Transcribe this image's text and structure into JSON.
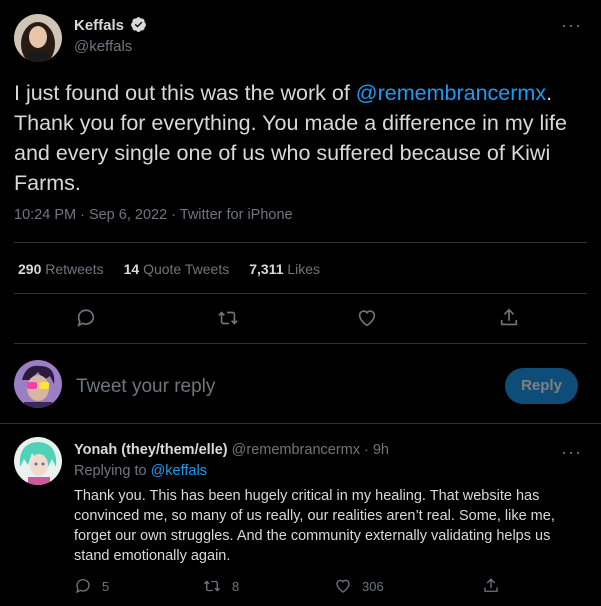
{
  "tweet": {
    "author_name": "Keffals",
    "author_handle": "@keffals",
    "verified": true,
    "more_label": "···",
    "text_before": "I just found out this was the work of ",
    "mention": "@remembrancermx",
    "text_after": ". Thank you for everything. You made a difference in my life and every single one of us who suffered because of Kiwi Farms.",
    "meta": "10:24 PM · Sep 6, 2022 · Twitter for iPhone",
    "stats": {
      "retweets_count": "290",
      "retweets_label": "Retweets",
      "quotes_count": "14",
      "quotes_label": "Quote Tweets",
      "likes_count": "7,311",
      "likes_label": "Likes"
    }
  },
  "compose": {
    "placeholder": "Tweet your reply",
    "reply_button": "Reply"
  },
  "reply": {
    "author_name": "Yonah (they/them/elle)",
    "author_handle_time": "@remembrancermx · 9h",
    "more_label": "···",
    "replying_prefix": "Replying to ",
    "replying_to": "@keffals",
    "text": "Thank you. This has been hugely critical in my healing. That website has convinced me, so many of us really, our realities aren’t real. Some, like me, forget our own struggles. And the community externally validating helps us stand emotionally again.",
    "reply_count": "5",
    "retweet_count": "8",
    "like_count": "306"
  },
  "colors": {
    "background": "#000000",
    "accent": "#1d9bf0",
    "muted": "#6e767d",
    "text": "#d9d9d9",
    "reply_button_bg": "#0e4d78"
  }
}
